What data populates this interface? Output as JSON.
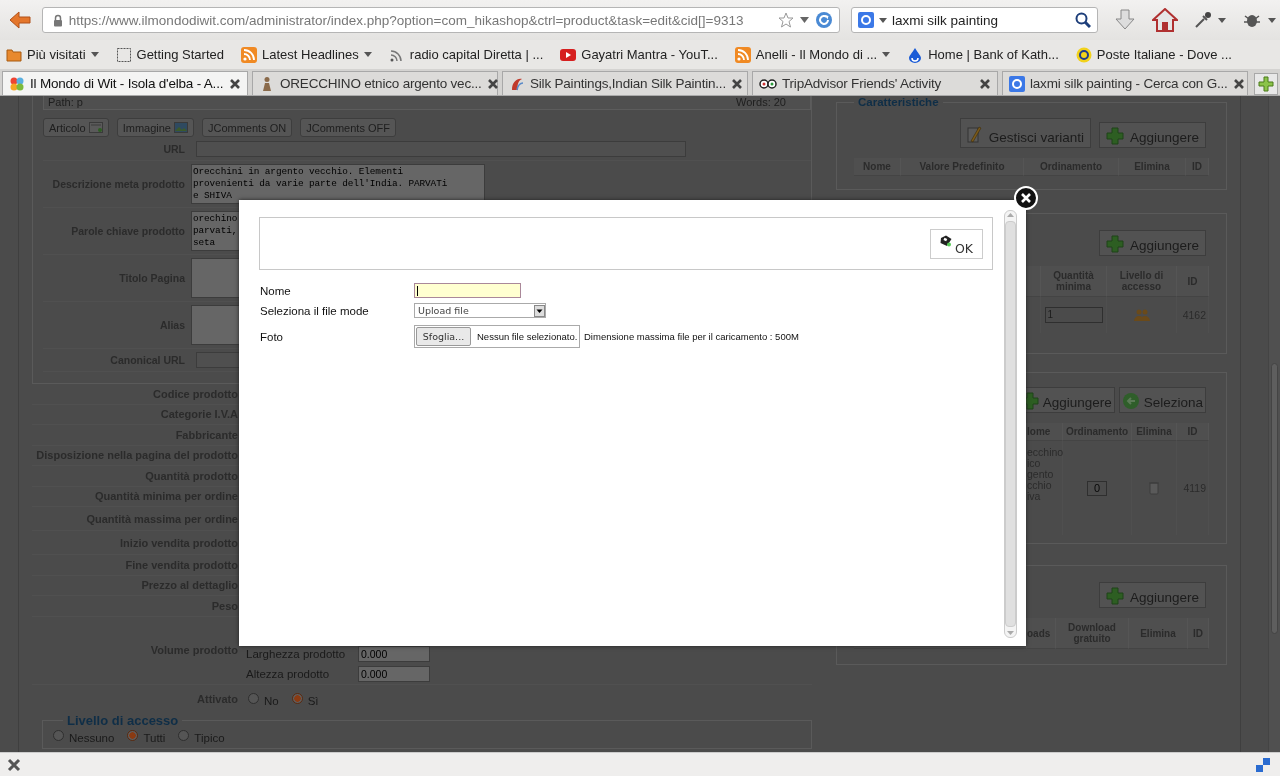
{
  "browser": {
    "url": "https://www.ilmondodiwit.com/administrator/index.php?option=com_hikashop&ctrl=product&task=edit&cid[]=9313",
    "search": "laxmi silk painting",
    "bookmarks": [
      {
        "label": "Più visitati",
        "has_menu": true
      },
      {
        "label": "Getting Started",
        "has_menu": false
      },
      {
        "label": "Latest Headlines",
        "has_menu": true
      },
      {
        "label": "radio capital Diretta | ...",
        "has_menu": false
      },
      {
        "label": "Gayatri Mantra - YouT...",
        "has_menu": false
      },
      {
        "label": "Anelli - Il Mondo di ...",
        "has_menu": true
      },
      {
        "label": "Home | Bank of Kath...",
        "has_menu": false
      },
      {
        "label": "Poste Italiane - Dove ...",
        "has_menu": false
      }
    ],
    "tabs": [
      {
        "label": "Il Mondo di Wit - Isola d'elba - A...",
        "selected": true
      },
      {
        "label": "ORECCHINO etnico argento vec...",
        "selected": false
      },
      {
        "label": "Silk Paintings,Indian Silk Paintin...",
        "selected": false
      },
      {
        "label": "TripAdvisor Friends' Activity",
        "selected": false
      },
      {
        "label": "laxmi silk painting - Cerca con G...",
        "selected": false
      }
    ]
  },
  "editor": {
    "path": "Path: p",
    "words": "Words: 20",
    "buttons": [
      "Articolo",
      "Immagine",
      "JComments ON",
      "JComments OFF"
    ]
  },
  "meta_fields": [
    {
      "label": "URL",
      "kind": "input"
    },
    {
      "label": "Descrizione meta prodotto",
      "kind": "textarea",
      "lines": [
        "Orecchini in argento vecchio. Elementi",
        "provenienti da varie parte dell'India. PARVATi",
        "e SHIVA"
      ]
    },
    {
      "label": "Parole chiave prodotto",
      "kind": "textarea",
      "lines": [
        "orechino",
        "parvati,",
        "seta"
      ]
    },
    {
      "label": "Titolo Pagina",
      "kind": "textarea"
    },
    {
      "label": "Alias",
      "kind": "textarea"
    },
    {
      "label": "Canonical URL",
      "kind": "input"
    }
  ],
  "product_fields": [
    "Codice prodotto",
    "Categorie I.V.A",
    "Fabbricante",
    "Disposizione nella pagina del prodotto",
    "Quantità prodotto",
    "Quantità minima per ordine",
    "Quantità massima per ordine",
    "Inizio vendita prodotto",
    "Fine vendita prodotto",
    "Prezzo al dettaglio",
    "Peso"
  ],
  "volume": {
    "label": "Volume prodotto",
    "dims": [
      {
        "label": "Larghezza prodotto",
        "value": "0.000"
      },
      {
        "label": "Altezza prodotto",
        "value": "0.000"
      }
    ]
  },
  "activated": {
    "label": "Attivato",
    "options": [
      {
        "label": "No",
        "selected": false
      },
      {
        "label": "Sì",
        "selected": true
      }
    ]
  },
  "access": {
    "title": "Livello di accesso",
    "options": [
      {
        "label": "Nessuno",
        "selected": false
      },
      {
        "label": "Tutti",
        "selected": true
      },
      {
        "label": "Tipico",
        "selected": false
      }
    ]
  },
  "characteristics": {
    "title": "Caratteristiche",
    "buttons": [
      {
        "label": "Gestisci varianti",
        "kind": "edit"
      },
      {
        "label": "Aggiungere",
        "kind": "add"
      }
    ],
    "columns": [
      "Nome",
      "Valore Predefinito",
      "Ordinamento",
      "Elimina",
      "ID"
    ]
  },
  "prices": {
    "buttons": [
      {
        "label": "Aggiungere",
        "kind": "add"
      }
    ],
    "columns": [
      "Quantità minima",
      "Livello di accesso",
      "ID"
    ],
    "rows": [
      {
        "quantity": "1",
        "id": "4162"
      }
    ]
  },
  "related": {
    "buttons": [
      {
        "label": "Aggiungere",
        "kind": "add"
      },
      {
        "label": "Seleziona",
        "kind": "select"
      }
    ],
    "columns": [
      "lome",
      "Ordinamento",
      "Elimina",
      "ID"
    ],
    "rows": [
      {
        "name": [
          "ecchino",
          "ico",
          "gento",
          "cchio",
          "iva"
        ],
        "order": "0",
        "id": "4119"
      }
    ]
  },
  "files": {
    "buttons": [
      {
        "label": "Aggiungere",
        "kind": "add"
      }
    ],
    "columns": [
      "oads",
      "Download gratuito",
      "Elimina",
      "ID"
    ]
  },
  "dialog": {
    "ok": "OK",
    "fields": [
      {
        "label": "Nome",
        "kind": "text",
        "focused": true
      },
      {
        "label": "Seleziona il file mode",
        "kind": "select",
        "value": "Upload file"
      },
      {
        "label": "Foto",
        "kind": "file",
        "button": "Sfoglia...",
        "value": "Nessun file selezionato.",
        "hint": "Dimensione massima file per il caricamento : 500M"
      }
    ]
  }
}
